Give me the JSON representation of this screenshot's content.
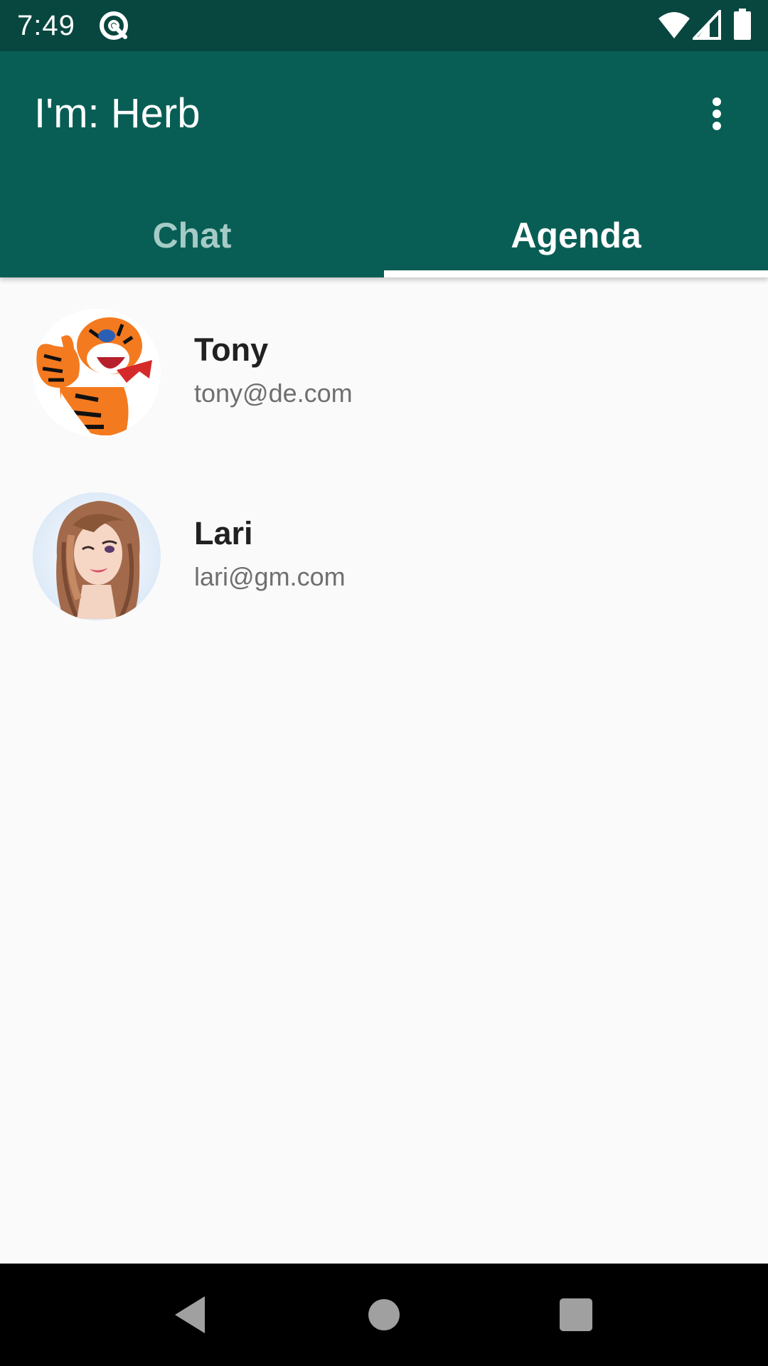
{
  "status_bar": {
    "time": "7:49",
    "app_icon": "notification-app-icon",
    "wifi_icon": "wifi-icon",
    "signal_icon": "signal-icon",
    "battery_icon": "battery-icon"
  },
  "app_bar": {
    "title": "I'm: Herb",
    "menu_icon": "more-vert-icon"
  },
  "tabs": [
    {
      "label": "Chat",
      "selected": false
    },
    {
      "label": "Agenda",
      "selected": true
    }
  ],
  "contacts": [
    {
      "name": "Tony",
      "email": "tony@de.com",
      "avatar": "tiger-avatar"
    },
    {
      "name": "Lari",
      "email": "lari@gm.com",
      "avatar": "woman-avatar"
    }
  ],
  "nav_bar": {
    "back_icon": "back-icon",
    "home_icon": "home-icon",
    "recents_icon": "recents-icon"
  },
  "colors": {
    "status_bar": "#07473f",
    "app_bar": "#085e55",
    "tab_inactive_text": "#a6cbc6",
    "tab_active_text": "#ffffff",
    "background": "#fafafa",
    "name_text": "#212121",
    "email_text": "#6f6f6f",
    "nav_bar": "#000000",
    "nav_icons": "#a0a0a0"
  }
}
